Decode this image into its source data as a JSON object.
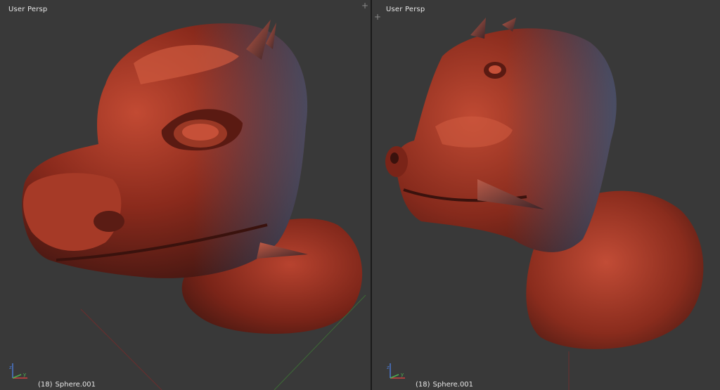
{
  "viewports": [
    {
      "view_label": "User Persp",
      "frame": "(18)",
      "object_name": "Sphere.001",
      "corner_icon": "plus-icon"
    },
    {
      "view_label": "User Persp",
      "frame": "(18)",
      "object_name": "Sphere.001",
      "corner_icon": "plus-icon"
    }
  ],
  "colors": {
    "background": "#393939",
    "model_base": "#8a2a1c",
    "model_highlight": "#d6553a",
    "model_shadow": "#3b1410",
    "rim_light": "#3d6e9a",
    "axis_x": "#d04040",
    "axis_y": "#4caf50",
    "axis_z": "#4a78d0"
  }
}
